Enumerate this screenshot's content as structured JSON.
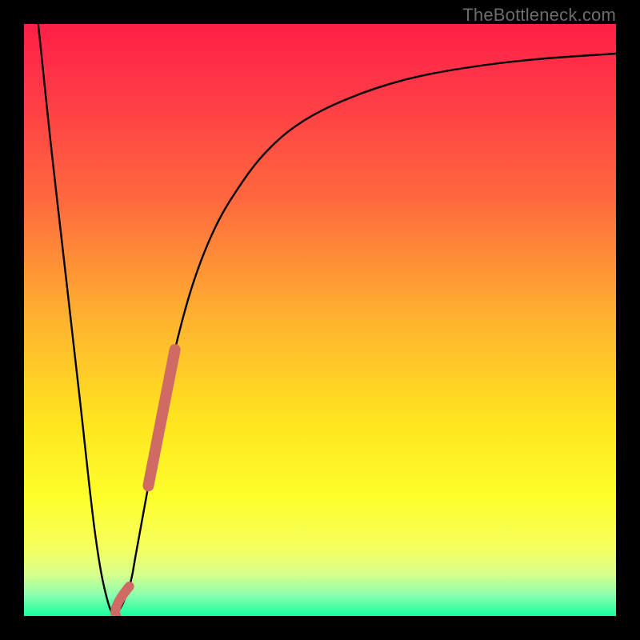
{
  "attribution": "TheBottleneck.com",
  "colors": {
    "frame": "#000000",
    "curve": "#000000",
    "highlight": "#cf6a64",
    "gradient_stops": [
      {
        "offset": 0.0,
        "color": "#ff1f47"
      },
      {
        "offset": 0.12,
        "color": "#ff3a47"
      },
      {
        "offset": 0.3,
        "color": "#ff6a3e"
      },
      {
        "offset": 0.5,
        "color": "#ffb330"
      },
      {
        "offset": 0.68,
        "color": "#ffe71f"
      },
      {
        "offset": 0.8,
        "color": "#fdff2b"
      },
      {
        "offset": 0.885,
        "color": "#f6ff5e"
      },
      {
        "offset": 0.93,
        "color": "#d7ff8b"
      },
      {
        "offset": 0.965,
        "color": "#8affb0"
      },
      {
        "offset": 1.0,
        "color": "#18ff9d"
      }
    ]
  },
  "chart_data": {
    "type": "line",
    "title": "",
    "xlabel": "",
    "ylabel": "",
    "xlim": [
      0,
      100
    ],
    "ylim": [
      0,
      100
    ],
    "note": "Axes are unlabeled in the source image; x/y values are normalized percentages estimated from pixel positions. y=0 is the bottom (green) edge, y=100 is the top (red) edge.",
    "series": [
      {
        "name": "bottleneck-curve",
        "x": [
          2.4,
          4.5,
          7.0,
          9.5,
          12.0,
          14.0,
          15.6,
          17.8,
          19.0,
          21.0,
          23.0,
          25.5,
          28.5,
          32.0,
          36.0,
          41.0,
          47.0,
          55.0,
          64.0,
          74.0,
          86.0,
          100.0
        ],
        "y": [
          100,
          80,
          58,
          36,
          14,
          3,
          0.5,
          5,
          11,
          22,
          33,
          45,
          56,
          65,
          72,
          78.5,
          83.5,
          87.5,
          90.5,
          92.5,
          94,
          95
        ]
      },
      {
        "name": "highlight-segment-upper",
        "x": [
          21.0,
          25.5
        ],
        "y": [
          22,
          45
        ]
      },
      {
        "name": "highlight-hook-lower",
        "x": [
          15.6,
          17.8
        ],
        "y": [
          0.5,
          5
        ]
      }
    ]
  }
}
